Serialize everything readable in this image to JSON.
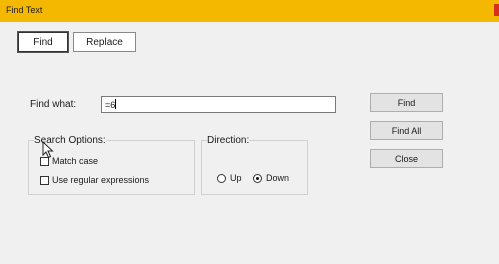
{
  "window": {
    "title": "Find Text",
    "accent_color": "#f5b800",
    "close_color": "#d6301c"
  },
  "tabs": [
    {
      "label": "Find",
      "active": true
    },
    {
      "label": "Replace",
      "active": false
    }
  ],
  "find_what": {
    "label": "Find what:",
    "value": "=6"
  },
  "search_options": {
    "title": "Search Options:",
    "match_case": {
      "label": "Match case",
      "checked": false
    },
    "regex": {
      "label": "Use regular expressions",
      "checked": false
    }
  },
  "direction": {
    "title": "Direction:",
    "up": {
      "label": "Up",
      "checked": false
    },
    "down": {
      "label": "Down",
      "checked": true
    }
  },
  "buttons": {
    "find": "Find",
    "find_all": "Find All",
    "close": "Close"
  },
  "icons": {
    "cursor": "mouse-pointer-icon"
  }
}
